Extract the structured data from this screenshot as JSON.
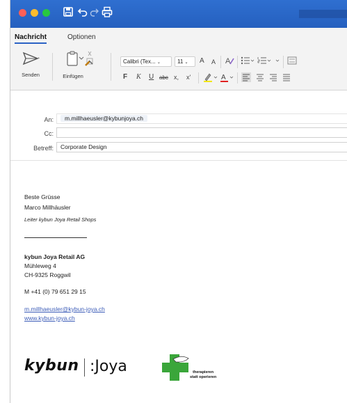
{
  "titlebar": {
    "icons": [
      "save-icon",
      "undo-icon",
      "redo-icon",
      "print-icon"
    ]
  },
  "tabs": [
    {
      "label": "Nachricht",
      "active": true
    },
    {
      "label": "Optionen",
      "active": false
    }
  ],
  "ribbon": {
    "send_label": "Senden",
    "paste_label": "Einfügen",
    "font_name": "Calibri (Tex...",
    "font_size": "11",
    "grow_font": "A",
    "shrink_font": "A",
    "bold": "F",
    "italic": "K",
    "underline": "U",
    "strike": "abc",
    "subscript": "x,",
    "superscript": "x'",
    "highlight_color": "#f2e600",
    "font_color": "#e02020"
  },
  "header": {
    "to_label": "An:",
    "to_value": "m.millhaeusler@kybunjoya.ch",
    "cc_label": "Cc:",
    "cc_value": "",
    "subject_label": "Betreff:",
    "subject_value": "Corporate Design"
  },
  "signature": {
    "greeting": "Beste Grüsse",
    "name": "Marco Millhäusler",
    "role": "Leiter kybun Joya Retail Shops",
    "company": "kybun Joya Retail AG",
    "street": "Mühleweg 4",
    "city": "CH-9325 Roggwil",
    "phone": "M +41  (0) 79 651 29 15",
    "email": "m.millhaeusler@kybun-joya.ch",
    "website": "www.kybun-joya.ch"
  },
  "logos": {
    "kybun": "kybun",
    "joya": ":Joya",
    "tagline_1": "therapieren",
    "tagline_2": "statt operieren",
    "cross_color": "#3aa63a"
  }
}
